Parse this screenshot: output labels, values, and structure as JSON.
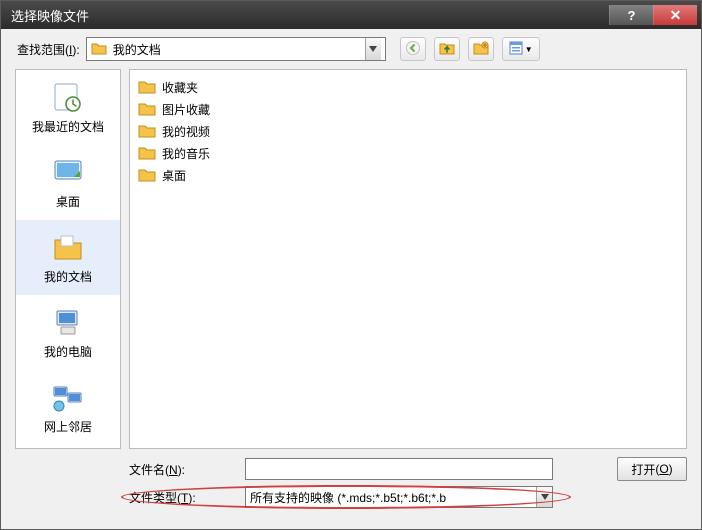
{
  "window": {
    "title": "选择映像文件"
  },
  "toprow": {
    "look_in_label_pre": "查找范围",
    "look_in_label_key": "I",
    "current_folder": "我的文档"
  },
  "toolbar": {
    "back": "后退",
    "up": "向上",
    "newfolder": "新建文件夹",
    "views": "查看"
  },
  "places": [
    {
      "label": "我最近的文档"
    },
    {
      "label": "桌面"
    },
    {
      "label": "我的文档"
    },
    {
      "label": "我的电脑"
    },
    {
      "label": "网上邻居"
    }
  ],
  "files": [
    {
      "name": "收藏夹"
    },
    {
      "name": "图片收藏"
    },
    {
      "name": "我的视频"
    },
    {
      "name": "我的音乐"
    },
    {
      "name": "桌面"
    }
  ],
  "bottom": {
    "file_name_label_pre": "文件名",
    "file_name_label_key": "N",
    "file_name_value": "",
    "file_type_label_pre": "文件类型",
    "file_type_label_key": "T",
    "file_type_value": "所有支持的映像 (*.mds;*.b5t;*.b6t;*.b",
    "open_label": "打开",
    "open_key": "O"
  }
}
